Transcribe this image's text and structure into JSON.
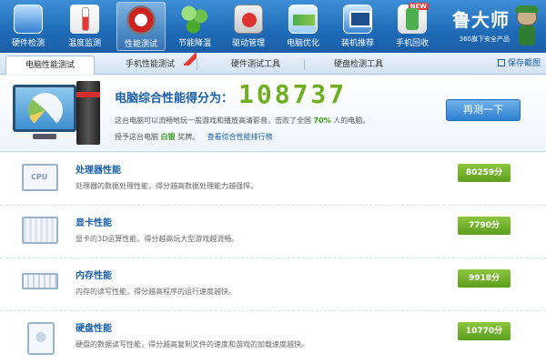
{
  "toolbar": {
    "items": [
      {
        "label": "硬件检测",
        "icon": "hardware-icon",
        "active": false
      },
      {
        "label": "温度监测",
        "icon": "thermometer-icon",
        "active": false
      },
      {
        "label": "性能测试",
        "icon": "gauge-icon",
        "active": true
      },
      {
        "label": "节能降温",
        "icon": "leaf-icon",
        "active": false
      },
      {
        "label": "驱动管理",
        "icon": "driver-icon",
        "active": false
      },
      {
        "label": "电脑优化",
        "icon": "optimize-icon",
        "active": false
      },
      {
        "label": "装机推荐",
        "icon": "monitor-icon",
        "active": false
      },
      {
        "label": "手机回收",
        "icon": "phone-icon",
        "active": false,
        "badge": "NEW"
      }
    ],
    "brand": {
      "name": "鲁大师",
      "subtitle": "360旗下安全产品"
    }
  },
  "tabs": {
    "items": [
      {
        "label": "电脑性能测试",
        "active": true
      },
      {
        "label": "手机性能测试",
        "active": false
      },
      {
        "label": "硬件测试工具",
        "active": false
      },
      {
        "label": "硬盘检测工具",
        "active": false
      }
    ],
    "save_link": "保存截图"
  },
  "score": {
    "label": "电脑综合性能得分为：",
    "value": "108737",
    "desc_prefix": "这台电脑可以流畅地玩一般游戏和播放高清影音，击败了全国",
    "desc_percent": "70%",
    "desc_suffix": "人的电脑。",
    "level_prefix": "授予这台电脑",
    "level": "白银",
    "level_suffix": "奖牌。",
    "rank_link": "查看综合性能排行榜",
    "retest_button": "再测一下"
  },
  "components": [
    {
      "title": "处理器性能",
      "desc": "处理器的数据处理性能，得分越高数据处理能力越强悍。",
      "score": "80259分",
      "icon": "cpu-icon",
      "icon_text": "CPU"
    },
    {
      "title": "显卡性能",
      "desc": "显卡的3D运算性能，得分越高玩大型游戏越流畅。",
      "score": "7790分",
      "icon": "graphics-card-icon"
    },
    {
      "title": "内存性能",
      "desc": "内存的读写性能，得分越高程序的运行速度越快。",
      "score": "9918分",
      "icon": "memory-icon"
    },
    {
      "title": "硬盘性能",
      "desc": "硬盘的数据读写性能，得分越高复制文件的速度和游戏的加载速度越快。",
      "score": "10770分",
      "icon": "hard-disk-icon"
    }
  ],
  "colors": {
    "accent": "#1a5ea6",
    "score_green": "#6fae1f",
    "badge_green": "#5d9e1e"
  }
}
